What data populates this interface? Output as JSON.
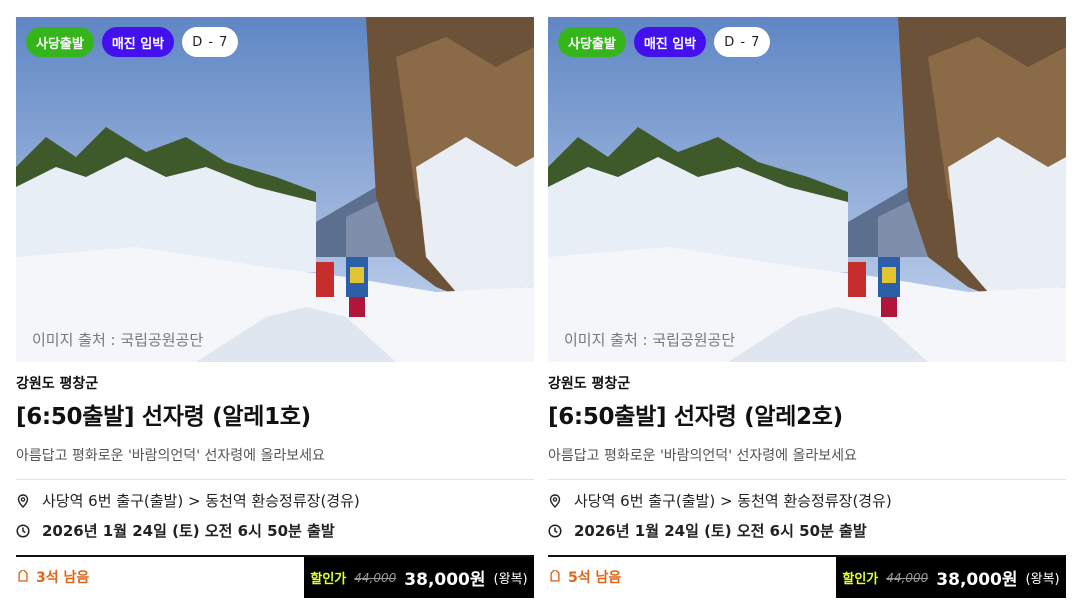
{
  "cards": [
    {
      "badges": [
        "사당출발",
        "매진 임박",
        "D - 7"
      ],
      "image_credit": "이미지 출처 : 국립공원공단",
      "region": "강원도 평창군",
      "title": "[6:50출발] 선자령 (알레1호)",
      "description": "아름답고 평화로운 '바람의언덕' 선자령에 올라보세요",
      "route": "사당역 6번 출구(출발) > 동천역 환승정류장(경유)",
      "departure": "2026년 1월 24일 (토)   오전 6시 50분 출발",
      "seats_left": "3석 남음",
      "price_label": "할인가",
      "original_price": "44,000",
      "sale_price": "38,000원",
      "trip_type": "(왕복)"
    },
    {
      "badges": [
        "사당출발",
        "매진 임박",
        "D - 7"
      ],
      "image_credit": "이미지 출처 : 국립공원공단",
      "region": "강원도 평창군",
      "title": "[6:50출발] 선자령 (알레2호)",
      "description": "아름답고 평화로운 '바람의언덕' 선자령에 올라보세요",
      "route": "사당역 6번 출구(출발) > 동천역 환승정류장(경유)",
      "departure": "2026년 1월 24일 (토)   오전 6시 50분 출발",
      "seats_left": "5석 남음",
      "price_label": "할인가",
      "original_price": "44,000",
      "sale_price": "38,000원",
      "trip_type": "(왕복)"
    }
  ],
  "icons": {
    "location": "location-pin-icon",
    "time": "clock-icon",
    "seats": "tag-icon"
  },
  "colors": {
    "badge_region": "#35b51b",
    "badge_soldout": "#4411ee",
    "seats_text": "#e0661a",
    "price_box": "#000000",
    "price_label": "#e4ff2b"
  }
}
